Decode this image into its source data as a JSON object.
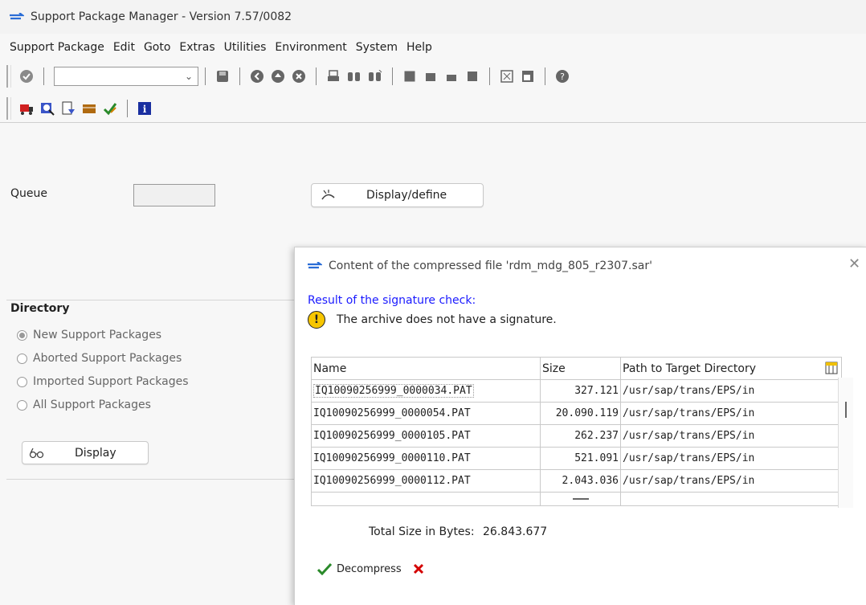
{
  "window": {
    "title": "Support Package Manager - Version 7.57/0082"
  },
  "menu": [
    "Support Package",
    "Edit",
    "Goto",
    "Extras",
    "Utilities",
    "Environment",
    "System",
    "Help"
  ],
  "main": {
    "queue_label": "Queue",
    "display_define_label": "Display/define",
    "directory_title": "Directory",
    "radios": [
      {
        "label": "New Support Packages",
        "selected": true
      },
      {
        "label": "Aborted Support Packages",
        "selected": false
      },
      {
        "label": "Imported Support Packages",
        "selected": false
      },
      {
        "label": "All Support Packages",
        "selected": false
      }
    ],
    "display_label": "Display"
  },
  "dialog": {
    "title": "Content of the compressed file 'rdm_mdg_805_r2307.sar'",
    "sig_title": "Result of the signature check:",
    "sig_message": "The archive does not have a signature.",
    "columns": [
      "Name",
      "Size",
      "Path to Target Directory"
    ],
    "rows": [
      {
        "name": "IQ10090256999_0000034.PAT",
        "size": "327.121",
        "path": "/usr/sap/trans/EPS/in"
      },
      {
        "name": "IQ10090256999_0000054.PAT",
        "size": "20.090.119",
        "path": "/usr/sap/trans/EPS/in"
      },
      {
        "name": "IQ10090256999_0000105.PAT",
        "size": "262.237",
        "path": "/usr/sap/trans/EPS/in"
      },
      {
        "name": "IQ10090256999_0000110.PAT",
        "size": "521.091",
        "path": "/usr/sap/trans/EPS/in"
      },
      {
        "name": "IQ10090256999_0000112.PAT",
        "size": "2.043.036",
        "path": "/usr/sap/trans/EPS/in"
      }
    ],
    "total_label": "Total Size in Bytes:",
    "total_value": "26.843.677",
    "decompress_label": "Decompress"
  },
  "colors": {
    "accent": "#1a1aff",
    "warning": "#f7c600",
    "ok": "#2a8a2a",
    "cancel": "#d40000"
  }
}
